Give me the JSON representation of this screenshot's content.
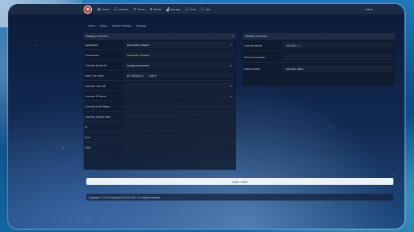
{
  "nav": {
    "items": [
      {
        "icon": "home-icon",
        "glyph": "▦",
        "label": "Home"
      },
      {
        "icon": "network-icon",
        "glyph": "☰",
        "label": "Network"
      },
      {
        "icon": "share-icon",
        "glyph": "⇆",
        "label": "Share"
      },
      {
        "icon": "media-icon",
        "glyph": "✚",
        "label": "Media"
      },
      {
        "icon": "chart-icon",
        "glyph": "▟",
        "label": "Manage"
      },
      {
        "icon": "tools-icon",
        "glyph": "☷",
        "label": "Tools"
      },
      {
        "icon": "info-icon",
        "glyph": "ⓘ",
        "label": "Info"
      }
    ],
    "right": "Admin"
  },
  "breadcrumb": [
    "Home",
    "Setup",
    "Router Settings",
    "Settings"
  ],
  "left_panel": {
    "title": "Settings Overview",
    "rows": [
      {
        "label": "Application",
        "value": "auto-detect wizard",
        "kind": "select"
      },
      {
        "label": "Connection",
        "value": "Automatic (default)",
        "kind": "gold"
      },
      {
        "label": "Connect Mode Wi",
        "value": "Always connected",
        "kind": "select"
      },
      {
        "label": "WAN Port Rate",
        "value": "IEC 60950-21       DHCP",
        "kind": "text"
      },
      {
        "label": "Connect Time Alt",
        "value": "",
        "kind": "select"
      },
      {
        "label": "Connect IP Mode",
        "value": "",
        "kind": "select"
      },
      {
        "label": "Connect Auth Status",
        "value": "",
        "kind": "text"
      },
      {
        "label": "Connect Option Alias",
        "value": "",
        "kind": "text"
      },
      {
        "label": "IP",
        "value": "",
        "kind": "text"
      },
      {
        "label": "Port",
        "value": "",
        "kind": "text"
      },
      {
        "label": "DNS",
        "value": "",
        "kind": "text"
      }
    ]
  },
  "right_panel": {
    "title": "Network Overview",
    "rows": [
      {
        "label": "Connect Mode",
        "value": "192.168.1.1"
      },
      {
        "label": "Other Connection",
        "value": ""
      },
      {
        "label": "Subnet Mask",
        "value": "255.255.255.0"
      }
    ]
  },
  "save_label": "Apply / Save",
  "footer": "Copyright © 2014 Router(DLK512) 2014. All rights reserved.",
  "colors": {
    "accent_gold": "#e8c25a",
    "logo_red": "#c0392b"
  }
}
